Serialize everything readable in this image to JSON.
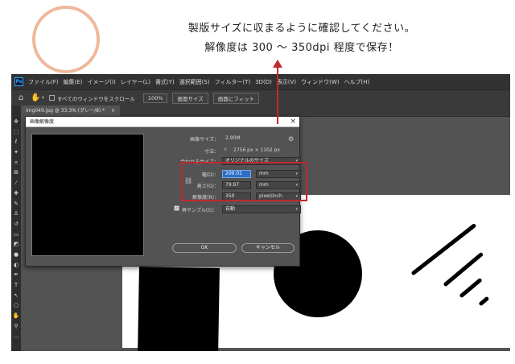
{
  "annotation": {
    "line1": "製版サイズに収まるように確認してください。",
    "line2": "解像度は 300 〜 350dpi 程度で保存！"
  },
  "app": {
    "logo": "Ps",
    "menu": [
      "ファイル(F)",
      "編集(E)",
      "イメージ(I)",
      "レイヤー(L)",
      "書式(Y)",
      "選択範囲(S)",
      "フィルター(T)",
      "3D(D)",
      "表示(V)",
      "ウィンドウ(W)",
      "ヘルプ(H)"
    ],
    "options": {
      "scroll_all_label": "すべてのウィンドウをスクロール",
      "btn_100": "100%",
      "btn_fit_screen": "画面サイズ",
      "btn_fill_screen": "画面にフィット"
    },
    "document_tab": "img049.jpg @ 33.3% (グレー/8) *",
    "document_tab_close": "×"
  },
  "dialog": {
    "title": "画像解像度",
    "close": "×",
    "image_size_label": "画像サイズ：",
    "image_size_value": "2.90M",
    "dimensions_label": "寸法：",
    "dimensions_value": "2756 px × 1102 px",
    "fit_to_label": "合わせるサイズ：",
    "fit_to_value": "オリジナルのサイズ",
    "width_label": "幅(D)：",
    "width_value": "200.01",
    "width_unit": "mm",
    "height_label": "高さ(G)：",
    "height_value": "79.97",
    "height_unit": "mm",
    "resolution_label": "解像度(R)：",
    "resolution_value": "350",
    "resolution_unit": "pixel/inch",
    "resample_label": "再サンプル(S)：",
    "resample_value": "自動",
    "ok": "OK",
    "cancel": "キャンセル"
  },
  "colors": {
    "highlight": "#c0282d",
    "circle": "#f0b89a"
  }
}
